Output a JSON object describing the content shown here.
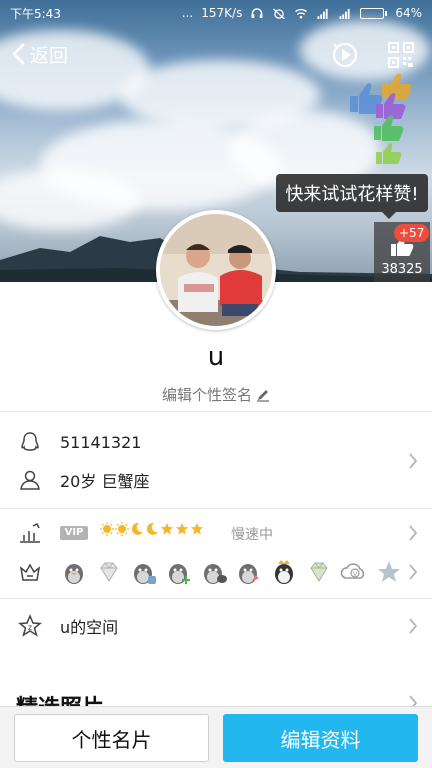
{
  "status_bar": {
    "time": "下午5:43",
    "dots": "...",
    "speed": "157K/s",
    "battery": "64%",
    "battery_level": 0.64
  },
  "header": {
    "back_label": "返回",
    "tooltip": "快来试试花样赞!",
    "like_badge": "+57",
    "like_count": "38325"
  },
  "profile": {
    "name": "u",
    "signature_prompt": "编辑个性签名"
  },
  "info": {
    "qq_number": "51141321",
    "age_sign": "20岁  巨蟹座"
  },
  "vip": {
    "tag": "VIP",
    "speed_text": "慢速中",
    "level_icons": [
      "sun-icon",
      "sun-icon",
      "moon-icon",
      "moon-icon",
      "star-icon",
      "star-icon",
      "star-icon"
    ]
  },
  "badges": [
    "penguin-badge",
    "diamond-badge",
    "penguin-badge",
    "penguin-badge",
    "penguin-badge",
    "penguin-badge",
    "penguin-badge",
    "diamond-badge",
    "cloud-v-badge",
    "star-badge"
  ],
  "space": {
    "label": "u的空间"
  },
  "section": {
    "title": "精选照片"
  },
  "buttons": {
    "card": "个性名片",
    "edit": "编辑资料"
  },
  "colors": {
    "accent": "#22b8ef",
    "badge_red": "#ef4d3c",
    "gold": "#f5b72a"
  }
}
